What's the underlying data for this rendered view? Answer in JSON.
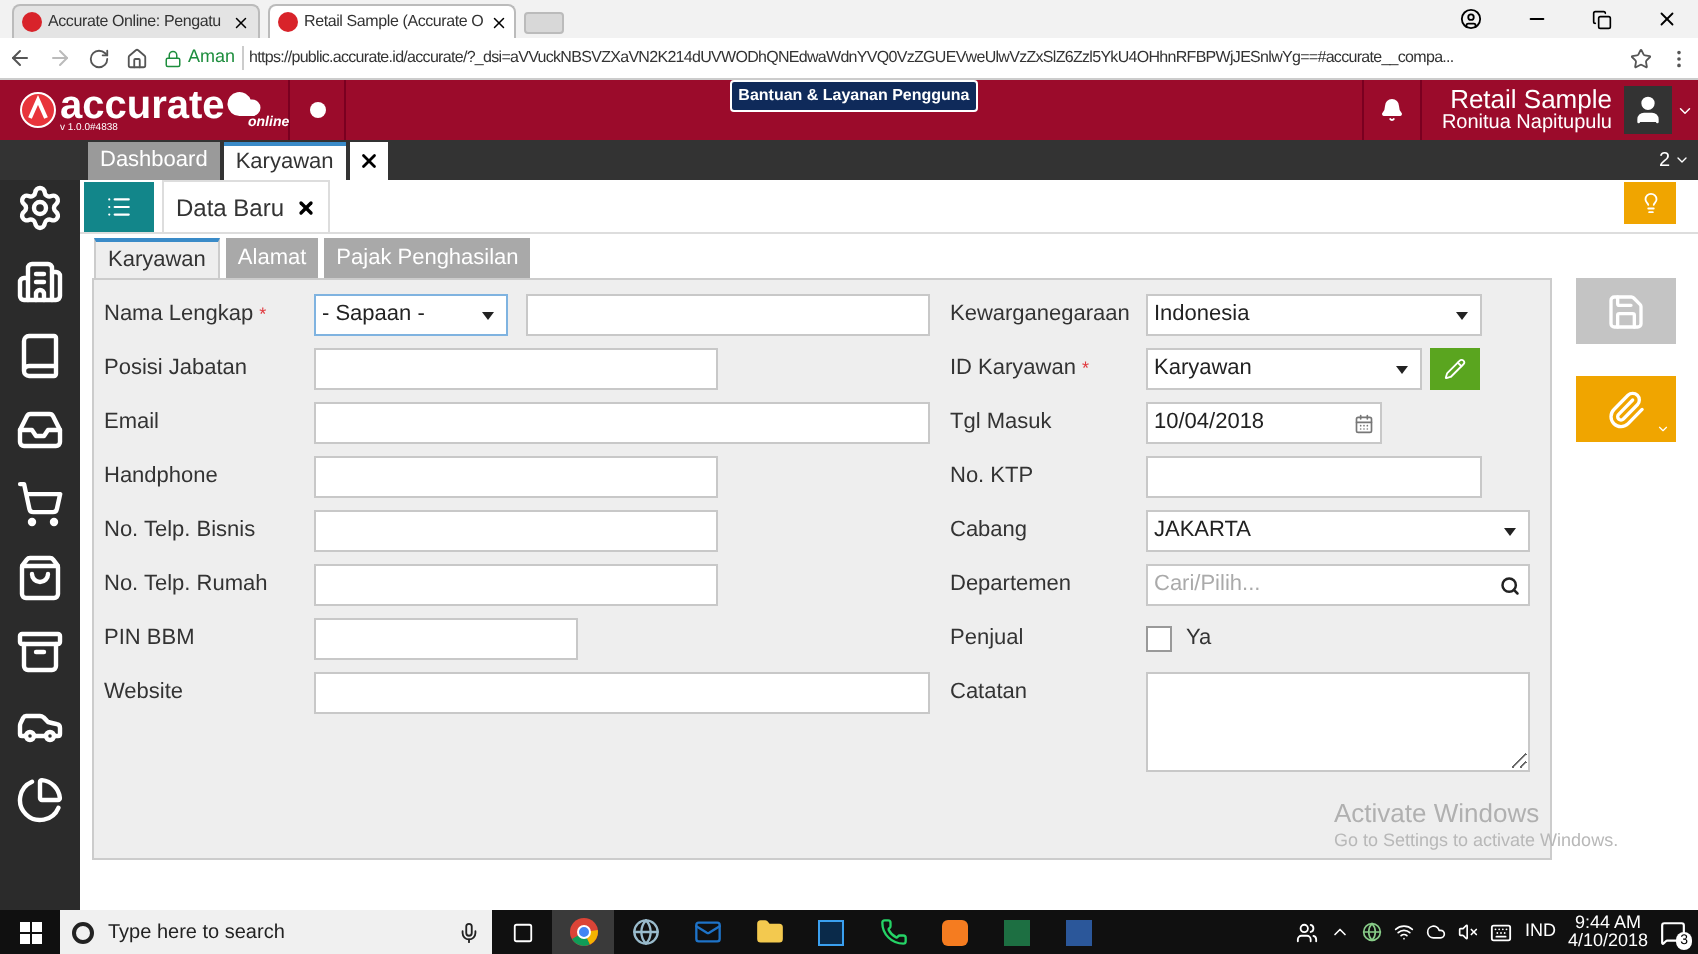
{
  "browser": {
    "tabs": [
      {
        "title": "Accurate Online: Pengatu",
        "selected": false
      },
      {
        "title": "Retail Sample (Accurate O",
        "selected": true
      }
    ],
    "security": "Aman",
    "url": "https://public.accurate.id/accurate/?_dsi=aVVuckNBSVZXaVN2K214dUVWODhQNEdwaWdnYVQ0VzZGUEVweUlwVzZxSlZ6Zzl5YkU4OHhnRFBPWjJESnlwYg==#accurate__compa..."
  },
  "header": {
    "logo": "accurate",
    "logo_sub": "online",
    "version": "v 1.0.0#4838",
    "help": "Bantuan & Layanan Pengguna",
    "company": "Retail Sample",
    "user": "Ronitua Napitupulu"
  },
  "module_tabs": [
    {
      "label": "Dashboard",
      "selected": false
    },
    {
      "label": "Karyawan",
      "selected": true
    }
  ],
  "tab_count": "2",
  "page_tab": "Data Baru",
  "form_tabs": [
    {
      "label": "Karyawan",
      "selected": true
    },
    {
      "label": "Alamat",
      "selected": false
    },
    {
      "label": "Pajak Penghasilan",
      "selected": false
    }
  ],
  "left_fields": [
    {
      "label": "Nama Lengkap",
      "required_mark": "*",
      "kind": "salutation",
      "value": "- Sapaan -"
    },
    {
      "label": "Posisi Jabatan",
      "kind": "text"
    },
    {
      "label": "Email",
      "kind": "text"
    },
    {
      "label": "Handphone",
      "kind": "text"
    },
    {
      "label": "No. Telp. Bisnis",
      "kind": "text"
    },
    {
      "label": "No. Telp. Rumah",
      "kind": "text"
    },
    {
      "label": "PIN BBM",
      "kind": "text"
    },
    {
      "label": "Website",
      "kind": "text"
    }
  ],
  "right_fields": [
    {
      "label": "Kewarganegaraan",
      "kind": "select",
      "value": "Indonesia"
    },
    {
      "label": "ID Karyawan",
      "required_mark": "*",
      "kind": "select_edit",
      "value": "Karyawan"
    },
    {
      "label": "Tgl Masuk",
      "kind": "date",
      "value": "10/04/2018"
    },
    {
      "label": "No. KTP",
      "kind": "text"
    },
    {
      "label": "Cabang",
      "kind": "select",
      "value": "JAKARTA"
    },
    {
      "label": "Departemen",
      "kind": "search",
      "placeholder": "Cari/Pilih..."
    },
    {
      "label": "Penjual",
      "kind": "checkbox",
      "option": "Ya",
      "checked": false
    },
    {
      "label": "Catatan",
      "kind": "textarea"
    }
  ],
  "activation": {
    "title": "Activate Windows",
    "hint": "Go to Settings to activate Windows."
  },
  "taskbar": {
    "search_placeholder": "Type here to search",
    "language": "IND",
    "time": "9:44 AM",
    "date": "4/10/2018",
    "notifications": "3"
  }
}
